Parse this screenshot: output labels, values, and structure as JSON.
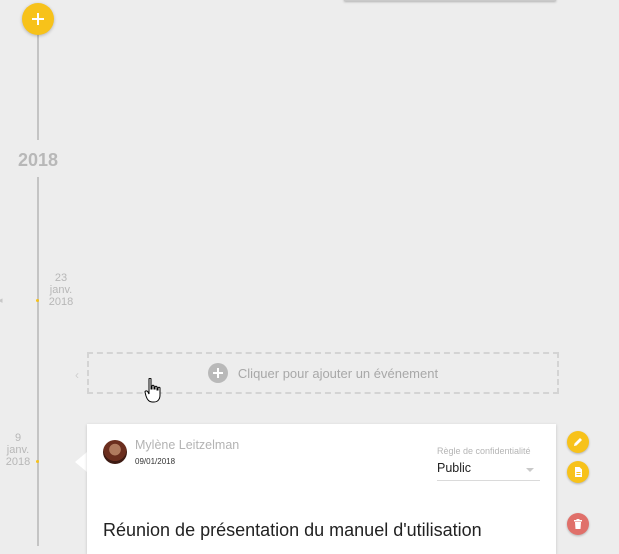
{
  "timeline": {
    "year": "2018",
    "entries": [
      {
        "date_lines": [
          "23",
          "janv.",
          "2018"
        ]
      },
      {
        "date_lines": [
          "9",
          "janv.",
          "2018"
        ]
      }
    ]
  },
  "add_event": {
    "label": "Cliquer pour ajouter un événement"
  },
  "event": {
    "author": "Mylène Leitzelman",
    "date": "09/01/2018",
    "privacy_label": "Règle de confidentialité",
    "privacy_value": "Public",
    "title": "Réunion de présentation du manuel d'utilisation"
  },
  "icons": {
    "add": "plus-icon",
    "add_event": "plus-circle-icon",
    "edit": "pencil-icon",
    "document": "document-icon",
    "delete": "trash-icon",
    "cursor": "hand-pointer-icon"
  },
  "colors": {
    "accent": "#f7c21a",
    "danger": "#e0706a",
    "background": "#ededed",
    "timeline": "#c4c4c4"
  }
}
